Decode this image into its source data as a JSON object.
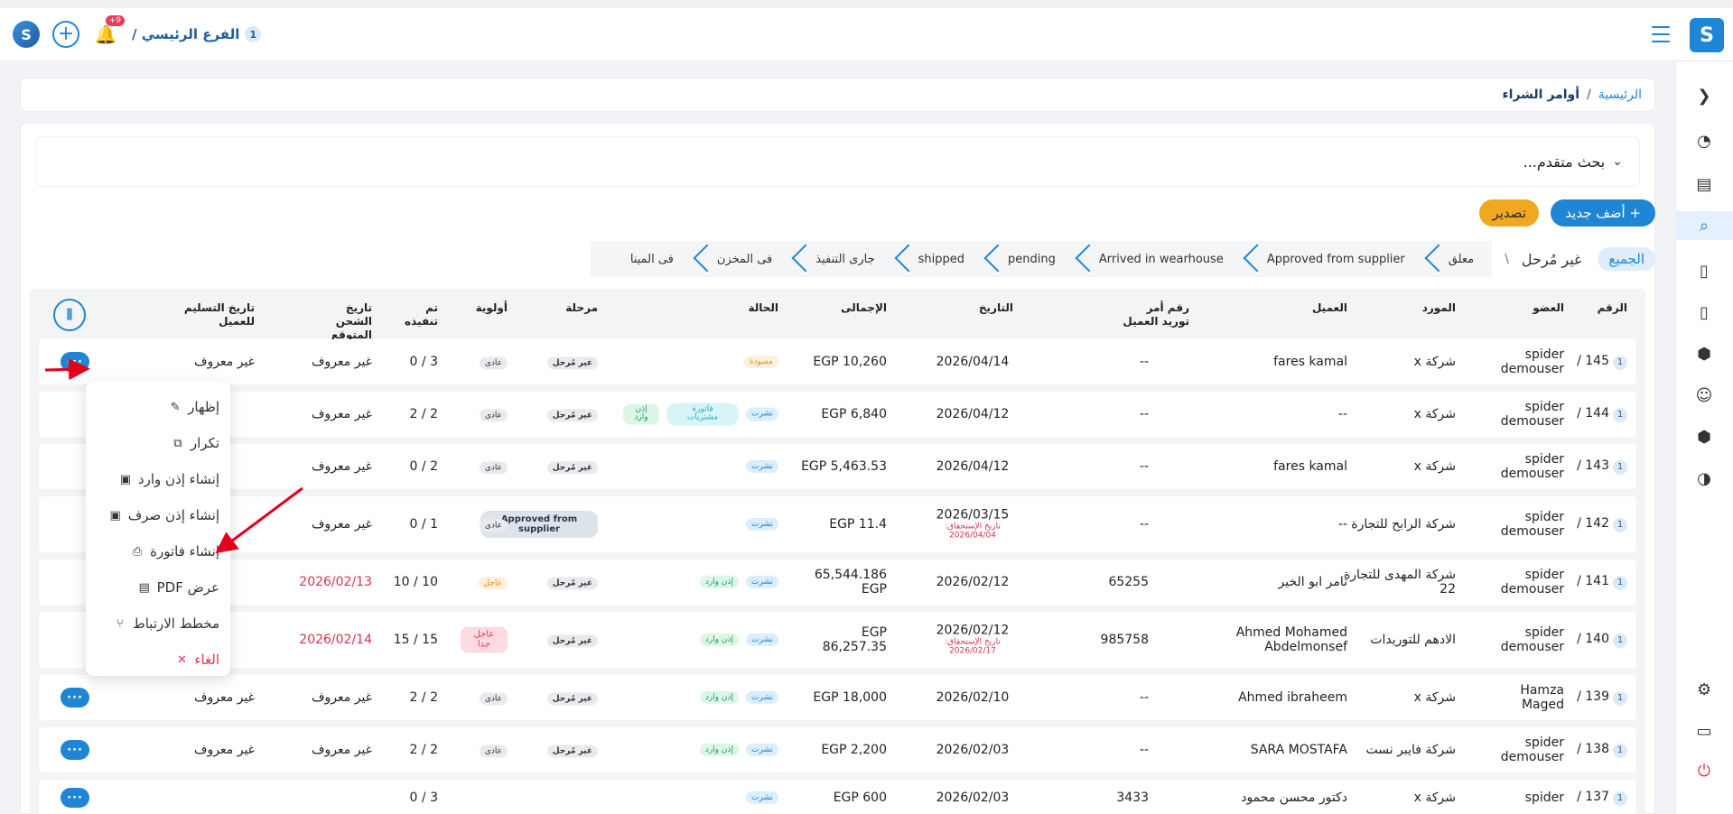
{
  "topbar": {
    "brand_letter": "S",
    "logo_letter": "S",
    "plus": "+",
    "bell_badge": "+9",
    "branch_num": "1",
    "branch_name": "الفرع الرئيسي /"
  },
  "breadcrumb": {
    "home": "الرئيسية",
    "sep": "/",
    "current": "أوامر الشراء"
  },
  "search": {
    "label": "بحث متقدم...",
    "chev": "⌄"
  },
  "actions": {
    "add_label": "+ أضف جديد",
    "export_label": "تصدير"
  },
  "stages": {
    "all": "الجميع",
    "unstaged": "غير مُرحل",
    "slash": "\\",
    "items": [
      "معلق",
      "Approved from supplier",
      "Arrived in wearhouse",
      "pending",
      "shipped",
      "جارى التنفيذ",
      "فى المخزن",
      "فى المينا"
    ]
  },
  "table": {
    "headers": {
      "id": "الرقم",
      "member": "العضو",
      "supplier": "المورد",
      "client": "العميل",
      "client_po": "رقم أمر توريد العميل",
      "date": "التاريخ",
      "total": "الإجمالى",
      "status": "الحالة",
      "stage": "مرحلة",
      "priority": "أولوية",
      "done": "تم تنفيذه",
      "ship_date": "تاريخ الشحن المتوقع",
      "delivery_date": "تاريخ التسليم للعميل",
      "columns_icon": "⫼"
    },
    "rows": [
      {
        "n": "1",
        "id": "145 /",
        "member": "spider demouser",
        "supplier": "شركة x",
        "client": "fares kamal",
        "po": "--",
        "date": "2026/04/14",
        "due_label": "",
        "due": "",
        "total": "EGP 10,260",
        "s1": "مسودة",
        "s2": "",
        "s3": "",
        "stage": "غير مُرحل",
        "prio": "عادى",
        "done": "3 / 0",
        "ship": "غير معروف",
        "deliv": "غير معروف"
      },
      {
        "n": "1",
        "id": "144 /",
        "member": "spider demouser",
        "supplier": "شركة x",
        "client": "--",
        "po": "--",
        "date": "2026/04/12",
        "due_label": "",
        "due": "",
        "total": "EGP 6,840",
        "s1": "نشرت",
        "s2": "فاتورة مشتريات",
        "s3": "إذن وارد",
        "stage": "غير مُرحل",
        "prio": "عادى",
        "done": "2 / 2",
        "ship": "غير معروف",
        "deliv": ""
      },
      {
        "n": "1",
        "id": "143 /",
        "member": "spider demouser",
        "supplier": "شركة x",
        "client": "fares kamal",
        "po": "--",
        "date": "2026/04/12",
        "due_label": "",
        "due": "",
        "total": "EGP 5,463.53",
        "s1": "نشرت",
        "s2": "",
        "s3": "",
        "stage": "غير مُرحل",
        "prio": "عادى",
        "done": "2 / 0",
        "ship": "غير معروف",
        "deliv": ""
      },
      {
        "n": "1",
        "id": "142 /",
        "member": "spider demouser",
        "supplier": "شركة الرابح للتجارة",
        "client": "--",
        "po": "--",
        "date": "2026/03/15",
        "due_label": "تاريخ الإستحقاق:",
        "due": "2026/04/04",
        "total": "EGP 11.4",
        "s1": "نشرت",
        "s2": "",
        "s3": "",
        "stage": "Approved from supplier",
        "prio": "عادى",
        "done": "1 / 0",
        "ship": "غير معروف",
        "deliv": ""
      },
      {
        "n": "1",
        "id": "141 /",
        "member": "spider demouser",
        "supplier": "شركة المهدى للتجارة 22",
        "client": "تامر ابو الخير",
        "po": "65255",
        "date": "2026/02/12",
        "due_label": "",
        "due": "",
        "total": "65,544.186 EGP",
        "s1": "نشرت",
        "s2": "إذن وارد",
        "s3": "",
        "stage": "غير مُرحل",
        "prio": "عاجل",
        "done": "10 / 10",
        "ship": "2026/02/13",
        "deliv": ""
      },
      {
        "n": "1",
        "id": "140 /",
        "member": "spider demouser",
        "supplier": "الادهم للتوريدات",
        "client": "Ahmed Mohamed Abdelmonsef",
        "po": "985758",
        "date": "2026/02/12",
        "due_label": "تاريخ الإستحقاق:",
        "due": "2026/02/17",
        "total": "EGP 86,257.35",
        "s1": "نشرت",
        "s2": "إذن وارد",
        "s3": "",
        "stage": "غير مُرحل",
        "prio": "عاجل جدا",
        "done": "15 / 15",
        "ship": "2026/02/14",
        "deliv": ""
      },
      {
        "n": "1",
        "id": "139 /",
        "member": "Hamza Maged",
        "supplier": "شركة x",
        "client": "Ahmed ibraheem",
        "po": "--",
        "date": "2026/02/10",
        "due_label": "",
        "due": "",
        "total": "EGP 18,000",
        "s1": "نشرت",
        "s2": "إذن وارد",
        "s3": "",
        "stage": "غير مُرحل",
        "prio": "عادى",
        "done": "2 / 2",
        "ship": "غير معروف",
        "deliv": "غير معروف"
      },
      {
        "n": "1",
        "id": "138 /",
        "member": "spider demouser",
        "supplier": "شركة فايبر نست",
        "client": "SARA MOSTAFA",
        "po": "--",
        "date": "2026/02/03",
        "due_label": "",
        "due": "",
        "total": "EGP 2,200",
        "s1": "نشرت",
        "s2": "إذن وارد",
        "s3": "",
        "stage": "غير مُرحل",
        "prio": "عادى",
        "done": "2 / 2",
        "ship": "غير معروف",
        "deliv": "غير معروف"
      },
      {
        "n": "1",
        "id": "137 /",
        "member": "spider",
        "supplier": "شركة x",
        "client": "دكتور محسن محمود",
        "po": "3433",
        "date": "2026/02/03",
        "due_label": "",
        "due": "",
        "total": "EGP 600",
        "s1": "نشرت",
        "s2": "",
        "s3": "",
        "stage": "",
        "prio": "",
        "done": "3 / 0",
        "ship": "",
        "deliv": ""
      }
    ]
  },
  "menu": {
    "items": [
      {
        "label": "إظهار",
        "icon": "✎"
      },
      {
        "label": "تكرار",
        "icon": "⧉"
      },
      {
        "label": "إنشاء إذن وارد",
        "icon": "▣"
      },
      {
        "label": "إنشاء إذن صرف",
        "icon": "▣"
      },
      {
        "label": "إنشاء فاتورة",
        "icon": "⎙"
      },
      {
        "label": "عرض PDF",
        "icon": "▤"
      },
      {
        "label": "مخطط الارتباط",
        "icon": "⑂"
      },
      {
        "label": "الغاء",
        "icon": "✕"
      }
    ]
  },
  "more_label": "···",
  "colors": {
    "primary": "#1f86d6",
    "warning": "#f0a91f",
    "danger": "#e5354f",
    "annotation": "#e3001b"
  }
}
